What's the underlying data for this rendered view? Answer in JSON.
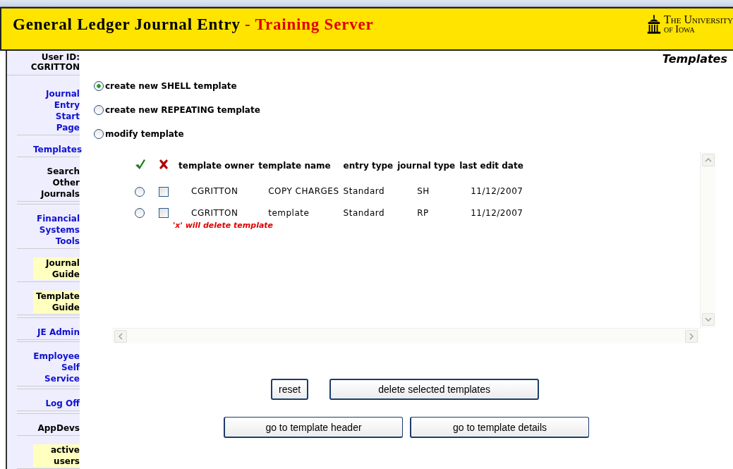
{
  "header": {
    "title": "General Ledger Journal Entry",
    "subtitle": "- Training Server",
    "logo_line_1": "The University",
    "logo_line_2": "of Iowa"
  },
  "sidebar": {
    "user_label": "User ID:",
    "user_id": "CGRITTON",
    "items": [
      {
        "label": "Journal Entry Start Page",
        "kind": "link"
      },
      {
        "label": "Templates",
        "kind": "link"
      },
      {
        "label": "Search Other Journals",
        "kind": "plain"
      },
      {
        "label": "Financial Systems Tools",
        "kind": "link"
      },
      {
        "label": "Journal Guide",
        "kind": "guide"
      },
      {
        "label": "Template Guide",
        "kind": "guide"
      },
      {
        "label": "JE Admin",
        "kind": "link"
      },
      {
        "label": "Employee Self Service",
        "kind": "link"
      },
      {
        "label": "Log Off",
        "kind": "link"
      },
      {
        "label": "AppDevs",
        "kind": "plain"
      },
      {
        "label": "active users",
        "kind": "guide"
      }
    ]
  },
  "page_title": "Templates",
  "options": [
    {
      "label": "create new SHELL template",
      "selected": true
    },
    {
      "label": "create new REPEATING template",
      "selected": false
    },
    {
      "label": "modify template",
      "selected": false
    }
  ],
  "table": {
    "columns": [
      "template owner",
      "template name",
      "entry type",
      "journal type",
      "last edit date"
    ],
    "rows": [
      {
        "selected": false,
        "checked": false,
        "cells": [
          "CGRITTON",
          "COPY CHARGES",
          "Standard",
          "SH",
          "11/12/2007"
        ]
      },
      {
        "selected": false,
        "checked": false,
        "cells": [
          "CGRITTON",
          "template",
          "Standard",
          "RP",
          "11/12/2007"
        ]
      }
    ],
    "note": "'x' will delete template"
  },
  "buttons": [
    "reset",
    "delete selected templates"
  ],
  "nav_buttons": [
    "go to template header",
    "go to template details"
  ]
}
